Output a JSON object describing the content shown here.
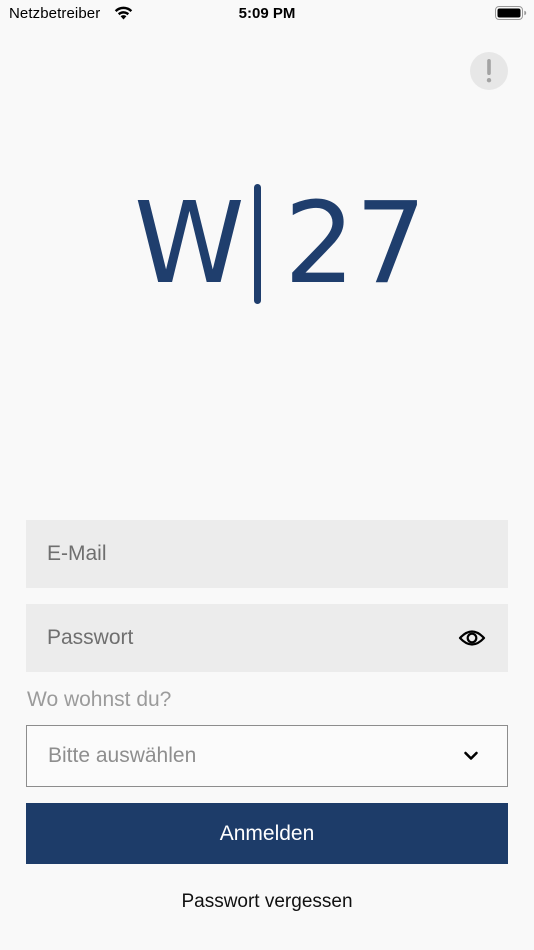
{
  "status_bar": {
    "carrier": "Netzbetreiber",
    "time": "5:09 PM",
    "wifi_icon": "wifi-icon",
    "battery_icon": "battery-icon"
  },
  "info_button": {
    "icon": "exclamation-icon"
  },
  "logo": {
    "left": "W",
    "right": "27",
    "color": "#1f3e6d"
  },
  "login_form": {
    "email": {
      "placeholder": "E-Mail",
      "value": ""
    },
    "password": {
      "placeholder": "Passwort",
      "value": "",
      "toggle_icon": "eye-icon"
    },
    "residence_label": "Wo wohnst du?",
    "residence_select": {
      "selected": "Bitte auswählen",
      "icon": "chevron-down-icon"
    },
    "submit_label": "Anmelden",
    "forgot_password": "Passwort vergessen"
  },
  "colors": {
    "accent": "#1d3c69",
    "background": "#f9f9f9",
    "field_background": "#ececec"
  }
}
